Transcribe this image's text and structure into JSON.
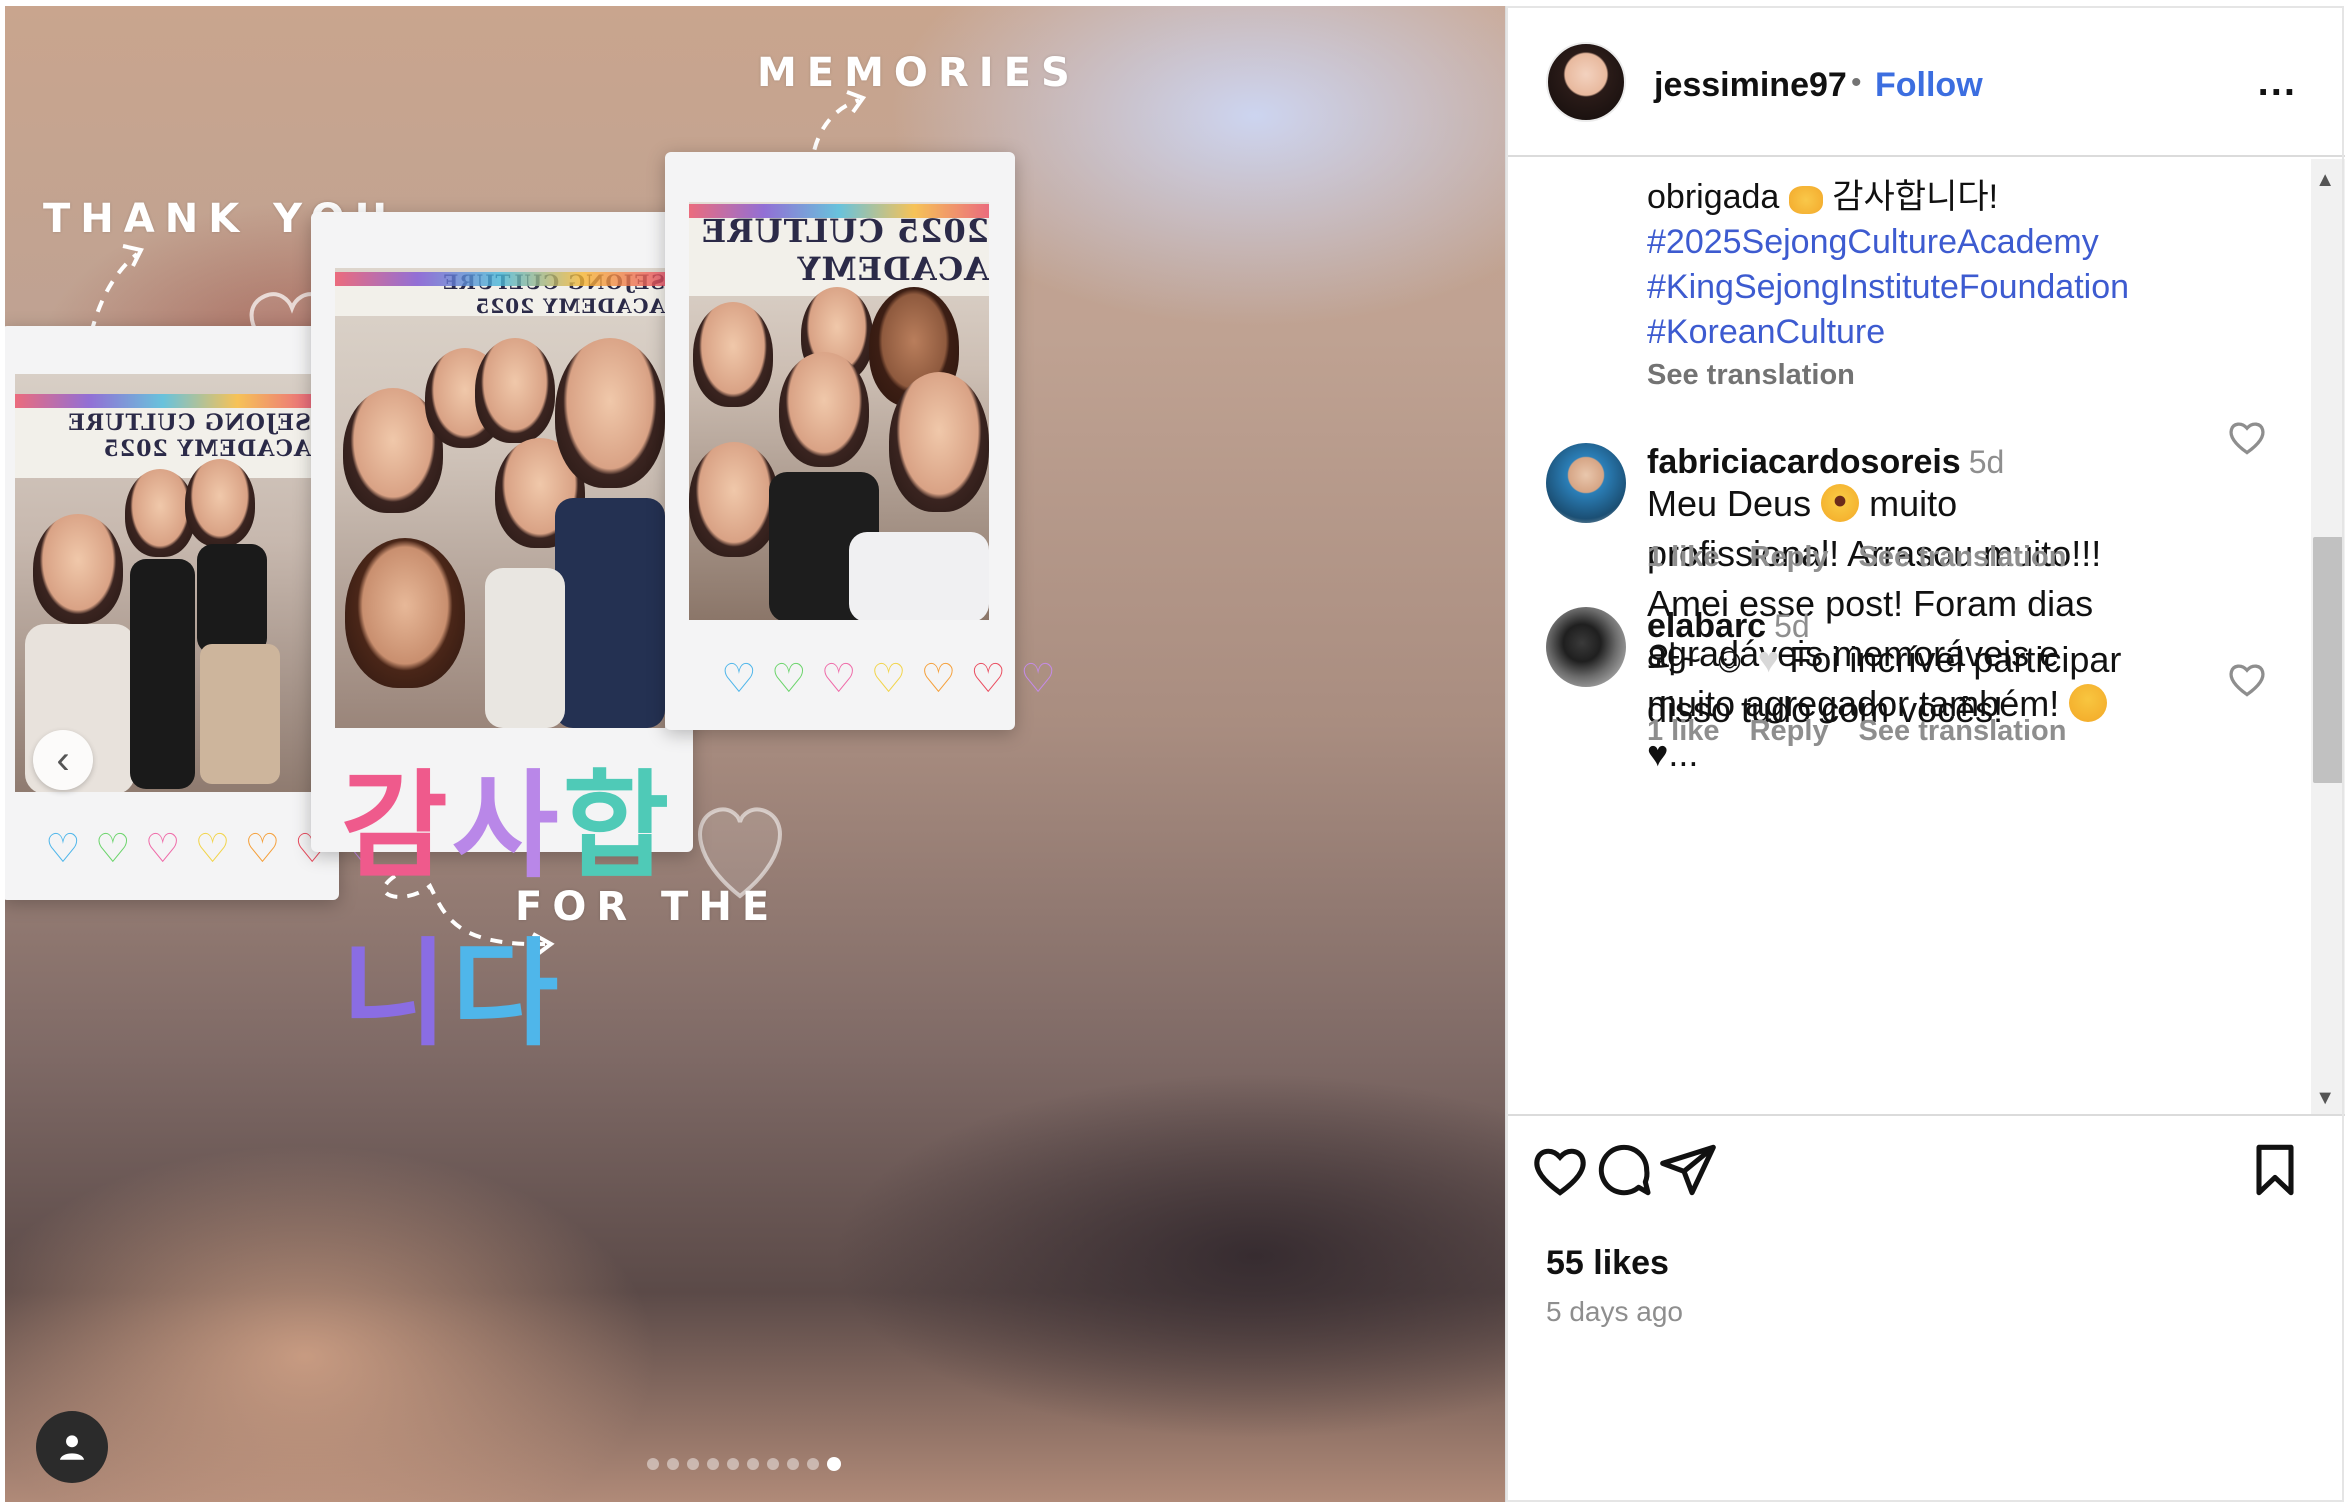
{
  "media": {
    "decorations": {
      "thank_you": "THANK YOU",
      "memories": "MEMORIES",
      "for_the": "FOR THE",
      "korean_center": [
        "감",
        "사",
        "합",
        "니",
        "다"
      ]
    },
    "banners": {
      "left": "SEJONG CULTURE ACADEMY 2025",
      "center": "SEJONG CULTURE ACADEMY 2025",
      "right": "2025 CULTURE ACADEMY"
    },
    "carousel": {
      "total": 10,
      "active_index": 9
    },
    "icons": {
      "prev": "chevron-left-icon",
      "tagged_users": "person-icon"
    }
  },
  "post": {
    "username": "jessimine97",
    "separator": "•",
    "follow_label": "Follow",
    "more_label": "...",
    "caption": {
      "line1_text": "obrigada",
      "line1_korean": "감사합니다!",
      "hashtags": [
        "#2025SejongCultureAcademy",
        "#KingSejongInstituteFoundation",
        "#KoreanCulture"
      ],
      "see_translation": "See translation"
    },
    "comments": [
      {
        "user": "fabriciacardosoreis",
        "time": "5d",
        "lines": [
          "Meu Deus",
          "muito",
          "profissional! Arrasou muito!!!",
          "Amei esse post! Foram dias",
          "agradáveis memoráveis e",
          "muito agregador também!",
          "♥..."
        ],
        "likes": "1 like",
        "reply": "Reply",
        "see_translation": "See translation"
      },
      {
        "user": "elabarc",
        "time": "5d",
        "lines": [
          "와~ ☺",
          "Foi incrível participar",
          "disso tudo com vocês!"
        ],
        "likes": "1 like",
        "reply": "Reply",
        "see_translation": "See translation"
      }
    ],
    "likes_count": "55 likes",
    "posted": "5 days ago",
    "icons": {
      "like": "heart-icon",
      "comment": "comment-icon",
      "share": "send-icon",
      "save": "bookmark-icon"
    }
  },
  "colors": {
    "link": "#3c6ee0",
    "hashtag": "#3d5bd0",
    "muted": "#8e8e8e",
    "divider": "#dbdbdb"
  }
}
